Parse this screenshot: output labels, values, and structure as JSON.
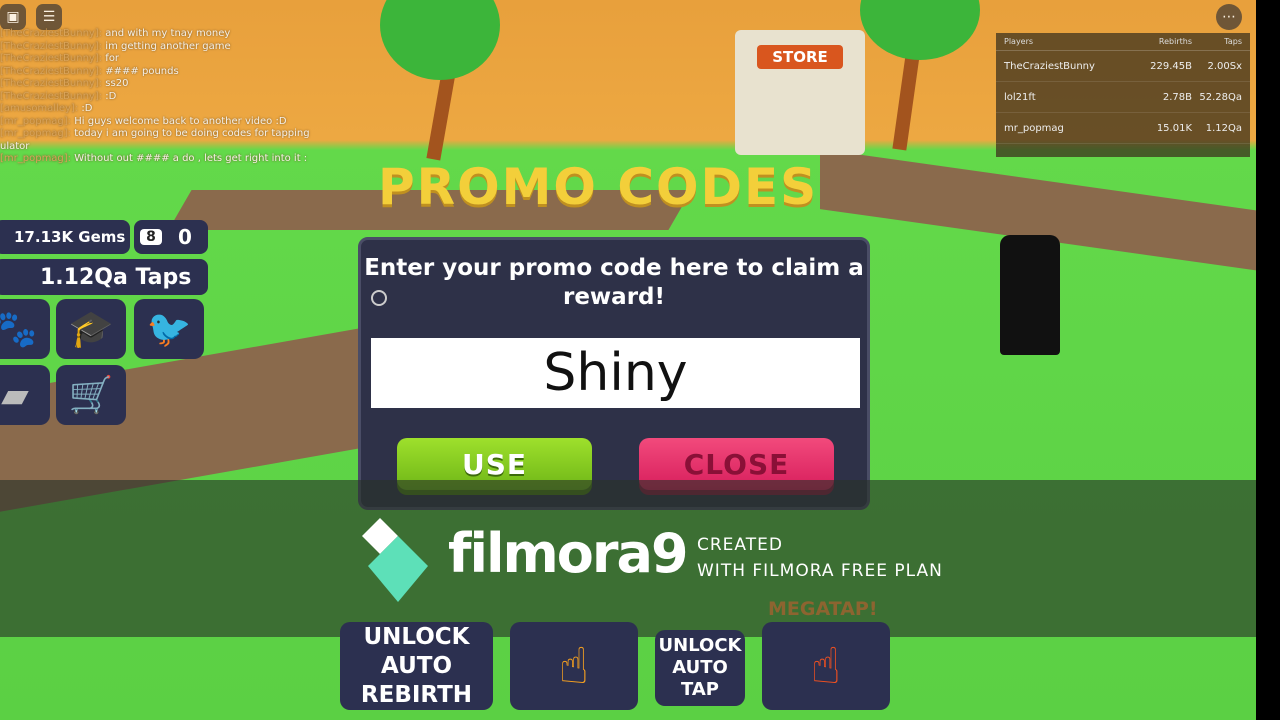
{
  "chat": [
    {
      "user": "[TheCraziestBunny]:",
      "msg": "and with my tnay money"
    },
    {
      "user": "[TheCraziestBunny]:",
      "msg": "im getting another game"
    },
    {
      "user": "[TheCraziestBunny]:",
      "msg": "for"
    },
    {
      "user": "[TheCraziestBunny]:",
      "msg": "#### pounds"
    },
    {
      "user": "[TheCraziestBunny]:",
      "msg": "ss20"
    },
    {
      "user": "[TheCraziestBunny]:",
      "msg": ":D"
    },
    {
      "user": "[amusomalley]:",
      "msg": ":D"
    },
    {
      "user": "[mr_popmag]:",
      "msg": "Hi guys welcome back to another video :D"
    },
    {
      "user": "[mr_popmag]:",
      "msg": "today i am going to be doing codes for tapping"
    },
    {
      "user": "",
      "msg": "ulator"
    },
    {
      "user": "[mr_popmag]:",
      "msg": "Without out #### a do , lets get right into it :"
    }
  ],
  "leaderboard": {
    "headers": [
      "Players",
      "Rebirths",
      "Taps"
    ],
    "rows": [
      [
        "TheCraziestBunny",
        "229.45B",
        "2.00Sx"
      ],
      [
        "lol21ft",
        "2.78B",
        "52.28Qa"
      ],
      [
        "mr_popmag",
        "15.01K",
        "1.12Qa"
      ]
    ]
  },
  "stats": {
    "gems": "17.13K Gems",
    "rebirth_count": "0",
    "taps": "1.12Qa Taps"
  },
  "scene": {
    "promo_sign": "PROMO CODES",
    "store_sign": "STORE"
  },
  "modal": {
    "title": "Enter your promo code here to claim a reward!",
    "code_value": "Shiny",
    "use": "USE",
    "close": "CLOSE"
  },
  "watermark": {
    "brand": "filmora9",
    "line1": "CREATED",
    "line2": "WITH FILMORA FREE PLAN"
  },
  "bottom": {
    "auto_rebirth": [
      "UNLOCK",
      "AUTO",
      "REBIRTH"
    ],
    "auto_tap": [
      "UNLOCK",
      "AUTO",
      "TAP"
    ],
    "megatap": "MEGATAP!"
  }
}
